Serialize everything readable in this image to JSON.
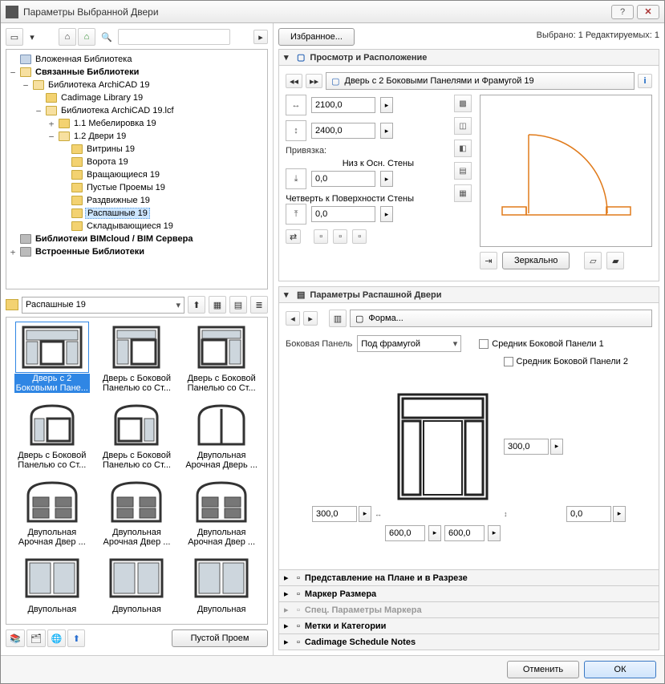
{
  "window": {
    "title": "Параметры Выбранной Двери"
  },
  "top": {
    "favorite": "Избранное...",
    "status": "Выбрано: 1 Редактируемых: 1"
  },
  "tree": [
    {
      "d": 0,
      "tw": "",
      "ico": "lib",
      "label": "Вложенная Библиотека"
    },
    {
      "d": 0,
      "tw": "−",
      "ico": "fold open",
      "label": "Связанные Библиотеки",
      "bold": true
    },
    {
      "d": 1,
      "tw": "−",
      "ico": "fold open",
      "label": "Библиотека ArchiCAD 19"
    },
    {
      "d": 2,
      "tw": "",
      "ico": "fold",
      "label": "Cadimage Library 19"
    },
    {
      "d": 2,
      "tw": "−",
      "ico": "fold open",
      "label": "Библиотека ArchiCAD 19.lcf"
    },
    {
      "d": 3,
      "tw": "+",
      "ico": "fold",
      "label": "1.1 Мебелировка 19"
    },
    {
      "d": 3,
      "tw": "−",
      "ico": "fold open",
      "label": "1.2 Двери 19"
    },
    {
      "d": 4,
      "tw": "",
      "ico": "fold",
      "label": "Витрины 19"
    },
    {
      "d": 4,
      "tw": "",
      "ico": "fold",
      "label": "Ворота 19"
    },
    {
      "d": 4,
      "tw": "",
      "ico": "fold",
      "label": "Вращающиеся 19"
    },
    {
      "d": 4,
      "tw": "",
      "ico": "fold",
      "label": "Пустые Проемы 19"
    },
    {
      "d": 4,
      "tw": "",
      "ico": "fold",
      "label": "Раздвижные 19"
    },
    {
      "d": 4,
      "tw": "",
      "ico": "fold",
      "label": "Распашные 19",
      "sel": true
    },
    {
      "d": 4,
      "tw": "",
      "ico": "fold",
      "label": "Складывающиеся 19"
    },
    {
      "d": 0,
      "tw": "",
      "ico": "misc",
      "label": "Библиотеки BIMcloud / BIM Сервера",
      "bold": true
    },
    {
      "d": 0,
      "tw": "+",
      "ico": "misc",
      "label": "Встроенные Библиотеки",
      "bold": true
    }
  ],
  "folder_combo": "Распашные 19",
  "thumbs": [
    {
      "cap": "Дверь с 2 Боковыми Пане...",
      "sel": true,
      "door": "d_2side_transom"
    },
    {
      "cap": "Дверь с Боковой Панелью со Ст...",
      "door": "d_side_transom_l"
    },
    {
      "cap": "Дверь с Боковой Панелью со Ст...",
      "door": "d_side_transom_r"
    },
    {
      "cap": "Дверь с Боковой Панелью со Ст...",
      "door": "d_side_arch_l"
    },
    {
      "cap": "Дверь с Боковой Панелью со Ст...",
      "door": "d_side_arch_r"
    },
    {
      "cap": "Двупольная Арочная Дверь ...",
      "door": "d_double_arch"
    },
    {
      "cap": "Двупольная Арочная Двер ...",
      "door": "d_double_panel1"
    },
    {
      "cap": "Двупольная Арочная Двер ...",
      "door": "d_double_panel2"
    },
    {
      "cap": "Двупольная Арочная Двер ...",
      "door": "d_double_panel3"
    },
    {
      "cap": "Двупольная",
      "door": "d_double_glass1"
    },
    {
      "cap": "Двупольная",
      "door": "d_double_glass2"
    },
    {
      "cap": "Двупольная",
      "door": "d_double_glass3"
    }
  ],
  "empty_opening_btn": "Пустой Проем",
  "sections": {
    "preview": {
      "title": "Просмотр и Расположение",
      "item_name": "Дверь с 2 Боковыми Панелями и Фрамугой 19",
      "width": "2100,0",
      "height": "2400,0",
      "anchor_label": "Привязка:",
      "anchor_base_label": "Низ к Осн. Стены",
      "anchor_base_val": "0,0",
      "reveal_label": "Четверть к Поверхности Стены",
      "reveal_val": "0,0",
      "mirror_btn": "Зеркально"
    },
    "params": {
      "title": "Параметры Распашной Двери",
      "form_btn": "Форма...",
      "side_panel_label": "Боковая Панель",
      "side_panel_combo": "Под фрамугой",
      "mullion1": "Средник Боковой Панели 1",
      "mullion2": "Средник Боковой Панели 2",
      "dim_top": "300,0",
      "dim_left": "300,0",
      "dim_right": "0,0",
      "dim_bottom_left": "600,0",
      "dim_bottom_right": "600,0"
    },
    "collapsed": [
      {
        "label": "Представление на Плане и в Разрезе"
      },
      {
        "label": "Маркер Размера"
      },
      {
        "label": "Спец. Параметры Маркера",
        "dim": true
      },
      {
        "label": "Метки и Категории"
      },
      {
        "label": "Cadimage Schedule Notes"
      }
    ]
  },
  "buttons": {
    "cancel": "Отменить",
    "ok": "ОК"
  }
}
